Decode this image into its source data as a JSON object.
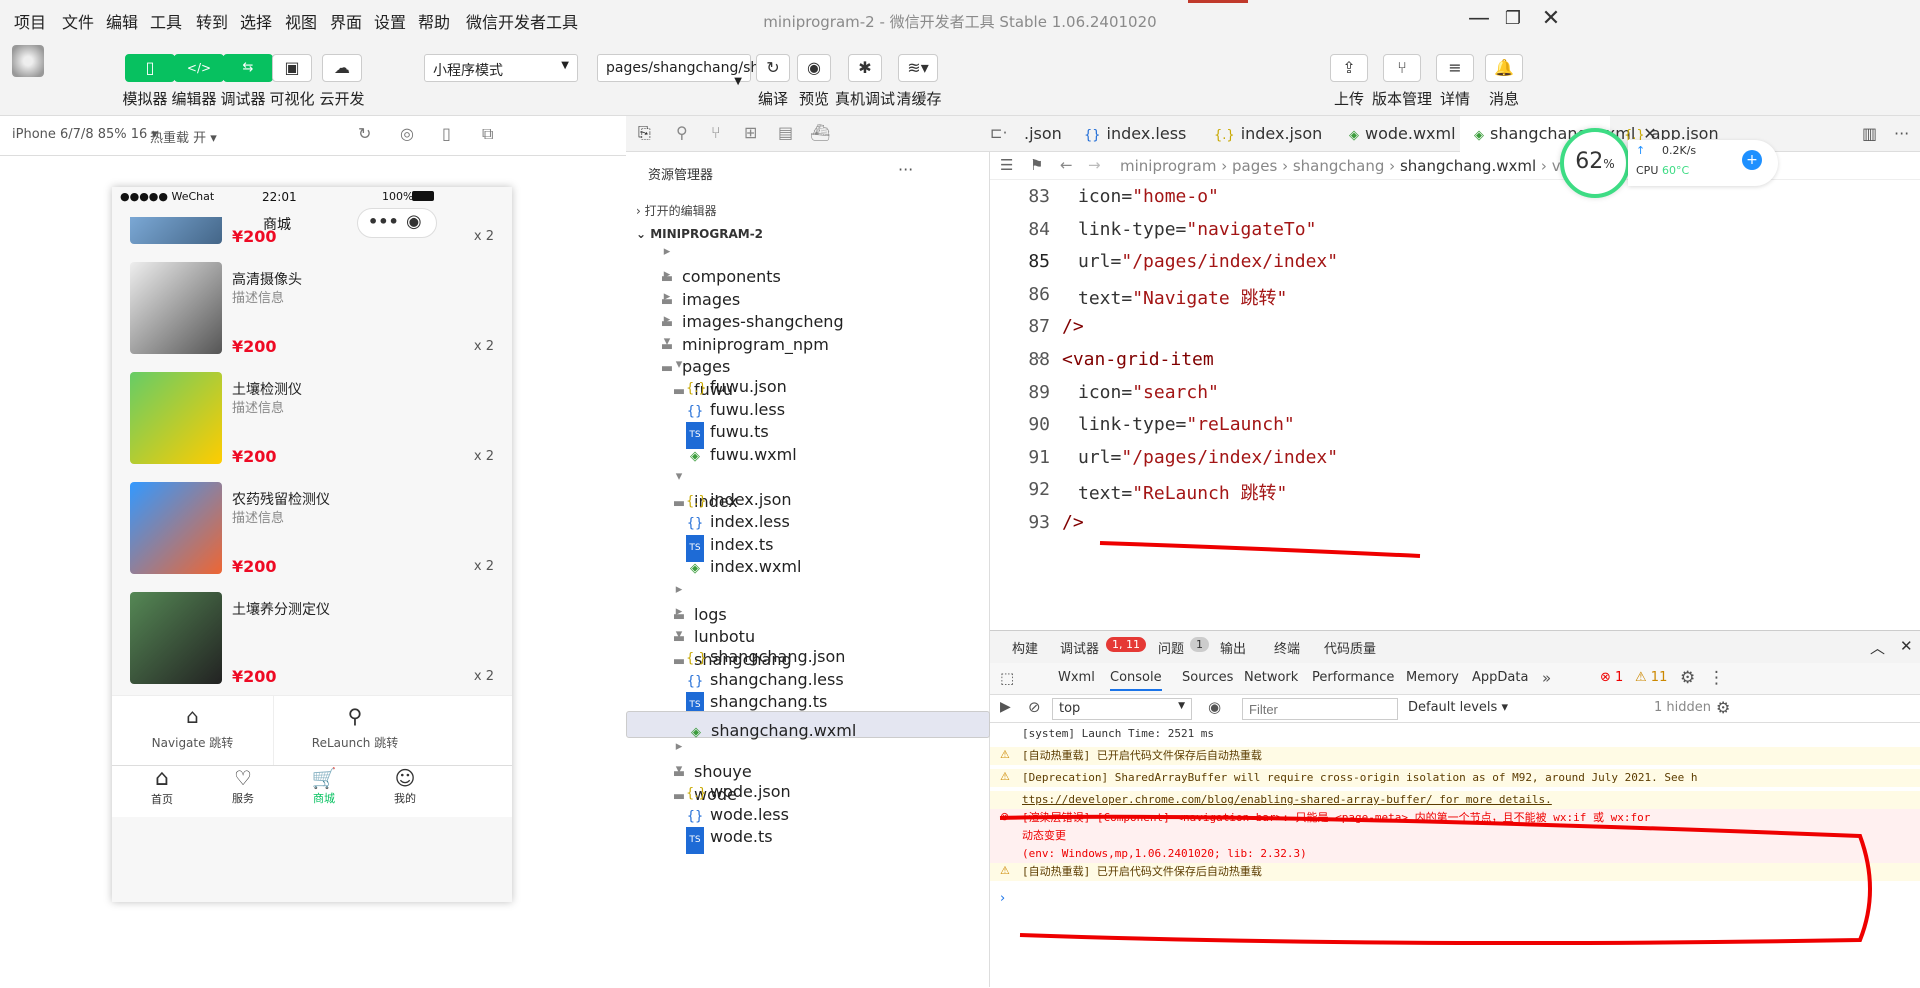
{
  "menubar": {
    "items": [
      "项目",
      "文件",
      "编辑",
      "工具",
      "转到",
      "选择",
      "视图",
      "界面",
      "设置",
      "帮助",
      "微信开发者工具"
    ],
    "title": "miniprogram-2 - 微信开发者工具 Stable 1.06.2401020"
  },
  "toolbar": {
    "simulator": "模拟器",
    "editor": "编辑器",
    "debugger": "调试器",
    "visual": "可视化",
    "cloud": "云开发",
    "mode_select": "小程序模式",
    "page_select": "pages/shangchang/sh...",
    "compile": "编译",
    "preview": "预览",
    "real_debug": "真机调试",
    "clear_cache": "清缓存",
    "upload": "上传",
    "version": "版本管理",
    "details": "详情",
    "messages": "消息"
  },
  "simulator": {
    "device": "iPhone 6/7/8 85% 16 ▾",
    "hot_reload": "热重载 开 ▾",
    "status": {
      "carrier": "●●●●● WeChat",
      "time": "22:01",
      "battery": "100%"
    },
    "nav_title": "商城",
    "products": [
      {
        "name": "",
        "desc": "",
        "price": "¥200",
        "qty": "x 2"
      },
      {
        "name": "高清摄像头",
        "desc": "描述信息",
        "price": "¥200",
        "qty": "x 2"
      },
      {
        "name": "土壤检测仪",
        "desc": "描述信息",
        "price": "¥200",
        "qty": "x 2"
      },
      {
        "name": "农药残留检测仪",
        "desc": "描述信息",
        "price": "¥200",
        "qty": "x 2"
      },
      {
        "name": "土壤养分测定仪",
        "desc": "",
        "price": "¥200",
        "qty": "x 2"
      }
    ],
    "grid": [
      {
        "label": "Navigate 跳转"
      },
      {
        "label": "ReLaunch 跳转"
      }
    ],
    "tabbar": [
      "首页",
      "服务",
      "商城",
      "我的"
    ],
    "accent": "#07c160",
    "price_color": "#ee0a24"
  },
  "explorer": {
    "title": "资源管理器",
    "open_editors": "打开的编辑器",
    "project": "MINIPROGRAM-2",
    "rows": [
      {
        "label": "components",
        "kind": "folder"
      },
      {
        "label": "images",
        "kind": "folder"
      },
      {
        "label": "images-shangcheng",
        "kind": "folder"
      },
      {
        "label": "miniprogram_npm",
        "kind": "folder"
      },
      {
        "label": "pages",
        "kind": "folder-open"
      },
      {
        "label": "fuwu",
        "kind": "folder-open"
      },
      {
        "label": "fuwu.json",
        "kind": "json"
      },
      {
        "label": "fuwu.less",
        "kind": "less"
      },
      {
        "label": "fuwu.ts",
        "kind": "ts"
      },
      {
        "label": "fuwu.wxml",
        "kind": "wxml"
      },
      {
        "label": "index",
        "kind": "folder-open"
      },
      {
        "label": "index.json",
        "kind": "json"
      },
      {
        "label": "index.less",
        "kind": "less"
      },
      {
        "label": "index.ts",
        "kind": "ts"
      },
      {
        "label": "index.wxml",
        "kind": "wxml"
      },
      {
        "label": "logs",
        "kind": "folder"
      },
      {
        "label": "lunbotu",
        "kind": "folder"
      },
      {
        "label": "shangchang",
        "kind": "folder-open"
      },
      {
        "label": "shangchang.json",
        "kind": "json"
      },
      {
        "label": "shangchang.less",
        "kind": "less"
      },
      {
        "label": "shangchang.ts",
        "kind": "ts"
      },
      {
        "label": "shangchang.wxml",
        "kind": "wxml"
      },
      {
        "label": "shouye",
        "kind": "folder"
      },
      {
        "label": "wode",
        "kind": "folder-open"
      },
      {
        "label": "wode.json",
        "kind": "json"
      },
      {
        "label": "wode.less",
        "kind": "less"
      },
      {
        "label": "wode.ts",
        "kind": "ts"
      }
    ]
  },
  "editor": {
    "tabs": [
      ".json",
      "index.less",
      "index.json",
      "wode.wxml",
      "shangchang.wxml",
      "app.json"
    ],
    "breadcrumb": [
      "miniprogram",
      "pages",
      "shangchang",
      "shangchang.wxml",
      "van-grid"
    ],
    "perf": {
      "percent": "62",
      "unit": "%",
      "net": "0.2K/s",
      "cpu_label": "CPU",
      "cpu": "60°C"
    },
    "lines": [
      {
        "n": "83",
        "attr": "icon=",
        "val": "\"home-o\""
      },
      {
        "n": "84",
        "attr": "link-type=",
        "val": "\"navigateTo\""
      },
      {
        "n": "85",
        "attr": "url=",
        "val": "\"/pages/index/index\""
      },
      {
        "n": "86",
        "attr": "text=",
        "val": "\"Navigate 跳转\""
      },
      {
        "n": "87",
        "attr": "",
        "val": "/>"
      },
      {
        "n": "88",
        "attr": "",
        "val": "<van-grid-item"
      },
      {
        "n": "89",
        "attr": "icon=",
        "val": "\"search\""
      },
      {
        "n": "90",
        "attr": "link-type=",
        "val": "\"reLaunch\""
      },
      {
        "n": "91",
        "attr": "url=",
        "val": "\"/pages/index/index\""
      },
      {
        "n": "92",
        "attr": "text=",
        "val": "\"ReLaunch 跳转\""
      },
      {
        "n": "93",
        "attr": "",
        "val": "/>"
      }
    ]
  },
  "console": {
    "top_tabs": [
      "构建",
      "调试器",
      "问题",
      "输出",
      "终端",
      "代码质量"
    ],
    "debugger_badge": "1, 11",
    "problems_badge": "1",
    "dev_tabs": [
      "Wxml",
      "Console",
      "Sources",
      "Network",
      "Performance",
      "Memory",
      "AppData"
    ],
    "err_count": "1",
    "warn_count": "11",
    "context": "top",
    "filter_placeholder": "Filter",
    "levels": "Default levels ▾",
    "hidden": "1 hidden",
    "logs": [
      {
        "type": "info",
        "text": "[system] Launch Time: 2521 ms"
      },
      {
        "type": "warn",
        "text": "[自动热重载] 已开启代码文件保存后自动热重载"
      },
      {
        "type": "warn",
        "text": "[Deprecation] SharedArrayBuffer will require cross-origin isolation as of M92, around July 2021. See h"
      },
      {
        "type": "warn-link",
        "text": "ttps://developer.chrome.com/blog/enabling-shared-array-buffer/ for more details."
      },
      {
        "type": "err",
        "text": "[渲染层错误] [Component] <navigation-bar>: 只能是 <page-meta> 内的第一个节点，且不能被 wx:if 或 wx:for"
      },
      {
        "type": "err-cont",
        "text": "动态变更"
      },
      {
        "type": "err-cont",
        "text": "(env: Windows,mp,1.06.2401020; lib: 2.32.3)"
      },
      {
        "type": "warn",
        "text": "[自动热重载] 已开启代码文件保存后自动热重载"
      }
    ]
  }
}
